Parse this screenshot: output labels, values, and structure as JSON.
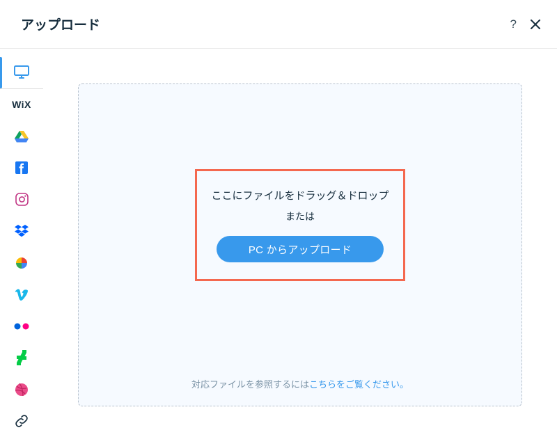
{
  "header": {
    "title": "アップロード",
    "help_icon": "?"
  },
  "sidebar": {
    "items": [
      {
        "name": "computer",
        "active": true
      },
      {
        "name": "wix"
      },
      {
        "name": "google-drive"
      },
      {
        "name": "facebook"
      },
      {
        "name": "instagram"
      },
      {
        "name": "dropbox"
      },
      {
        "name": "google-photos"
      },
      {
        "name": "vimeo"
      },
      {
        "name": "flickr"
      },
      {
        "name": "deviantart"
      },
      {
        "name": "dribbble"
      },
      {
        "name": "link"
      }
    ],
    "wix_label": "WiX"
  },
  "dropzone": {
    "drag_text": "ここにファイルをドラッグ＆ドロップ",
    "or_text": "または",
    "upload_label": "PC からアップロード"
  },
  "footer": {
    "plain": "対応ファイルを参照するには",
    "link": "こちらをご覧ください。"
  },
  "colors": {
    "accent": "#3899ec",
    "highlight_border": "#f4684f"
  }
}
